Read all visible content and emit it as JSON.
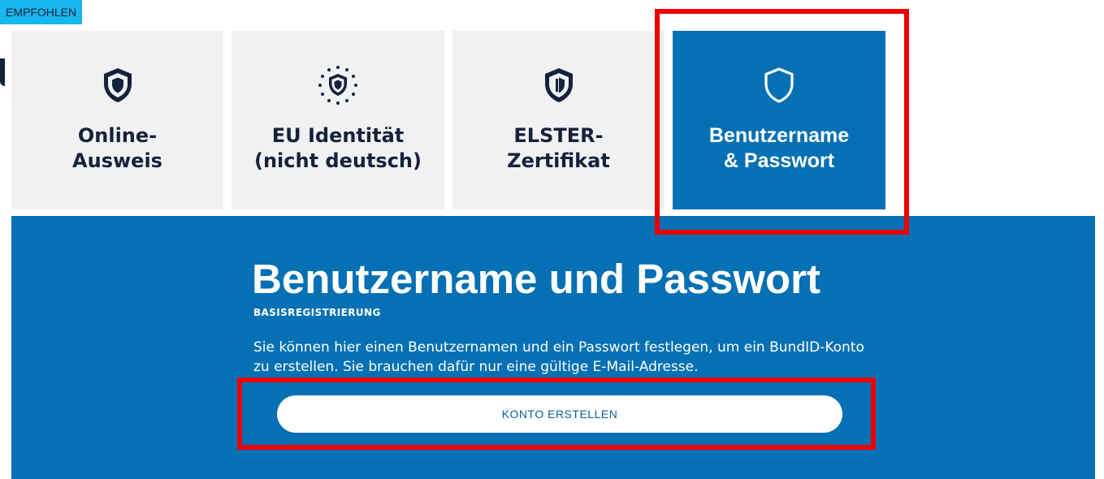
{
  "tabs": [
    {
      "label": "Online-\nAusweis",
      "icon": "shield-icon",
      "active": false
    },
    {
      "label": "EU Identität\n(nicht deutsch)",
      "icon": "eu-stars-shield-icon",
      "active": false
    },
    {
      "label": "ELSTER-\nZertifikat",
      "icon": "elster-shield-icon",
      "active": false
    },
    {
      "label": "Benutzername\n& Passwort",
      "icon": "shield-outline-icon",
      "active": true
    }
  ],
  "badge": {
    "label": "EMPFOHLEN"
  },
  "panel": {
    "title": "Benutzername und Passwort",
    "subtitle": "BASISREGISTRIERUNG",
    "description": "Sie können hier einen Benutzernamen und ein Passwort festlegen, um ein BundID-Konto zu erstellen. Sie brauchen dafür nur eine gültige E-Mail-Adresse.",
    "button_label": "KONTO ERSTELLEN"
  },
  "colors": {
    "primary": "#0570b3",
    "tab_background": "#eff1f3",
    "dark_text": "#16213a",
    "badge": "#16b8ed",
    "highlight": "#ee0000"
  }
}
